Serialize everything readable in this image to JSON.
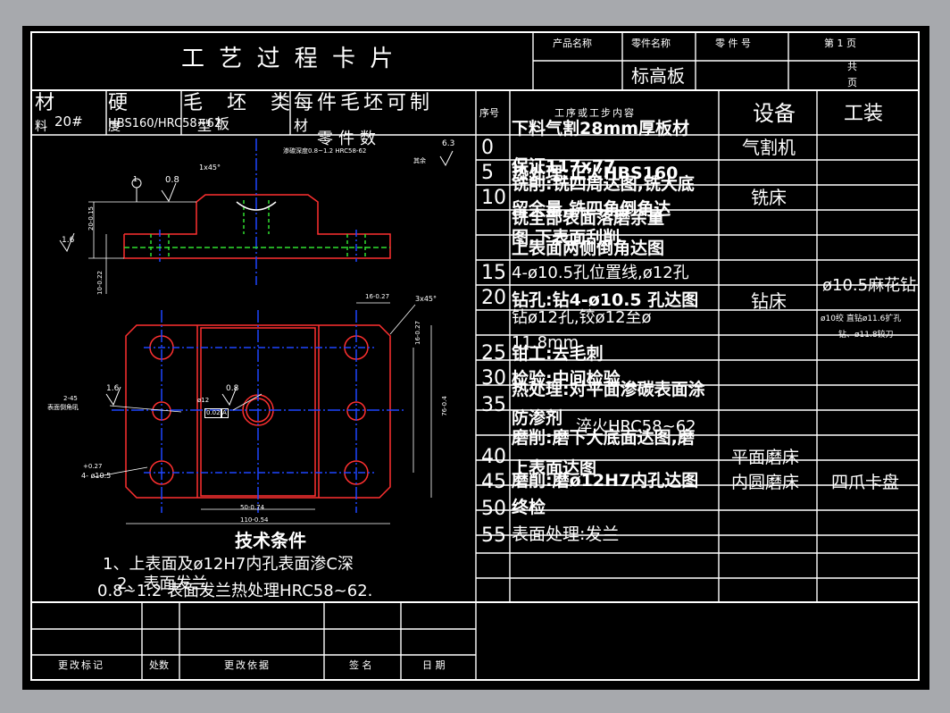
{
  "card": {
    "title": "工 艺 过 程 卡 片",
    "product_name_label": "产品名称",
    "part_name_label": "零件名称",
    "part_number_label": "零 件 号",
    "page_label": "第  1  页",
    "part_name_value": "标高板",
    "total_label": "共",
    "page_unit": "页"
  },
  "material_row": {
    "material_label": "材",
    "material_label_2": "料",
    "material_value": "20#",
    "hardness_label": "硬",
    "hardness_label_2": "度",
    "hardness_value": "HBS160/HRC58~62",
    "blank_type_label": "毛 坯 类",
    "blank_type_label_2": "型",
    "blank_type_value": "板",
    "per_blank_label": "每件毛坯可制",
    "per_blank_label_2": "材",
    "part_count_label": "零件数"
  },
  "process_table": {
    "headers": {
      "seq": "序号",
      "content": "工序或工步内容",
      "equipment": "设备",
      "tooling": "工装"
    },
    "rows": [
      {
        "seq": "0",
        "content": "下料气割28mm厚板材",
        "equipment": "气割机",
        "tooling": ""
      },
      {
        "seq": "5",
        "content": "保证117x77",
        "equipment": "",
        "tooling": ""
      },
      {
        "seq": "5",
        "content": "热处理:正火HBS160",
        "equipment": "",
        "tooling": ""
      },
      {
        "seq": "10",
        "content": "铣削:铣四周达图,铣大底",
        "equipment": "铣床",
        "tooling": ""
      },
      {
        "seq": "",
        "content": "留余量,铣四角倒角达",
        "equipment": "",
        "tooling": ""
      },
      {
        "seq": "",
        "content": "铣全部表面落磨余量",
        "equipment": "",
        "tooling": ""
      },
      {
        "seq": "",
        "content": "图,下表面刮削",
        "equipment": "",
        "tooling": ""
      },
      {
        "seq": "",
        "content": "上表面两侧倒角达图",
        "equipment": "",
        "tooling": ""
      },
      {
        "seq": "15",
        "content": "4-ø10.5孔位置线,ø12孔",
        "equipment": "",
        "tooling": ""
      },
      {
        "seq": "20",
        "content": "钻孔:钻4-ø10.5 孔达图",
        "equipment": "钻床",
        "tooling": "ø10.5麻花钻"
      },
      {
        "seq": "",
        "content": "钻ø12孔,铰ø12至ø",
        "equipment": "",
        "tooling": ""
      },
      {
        "seq": "",
        "content": "11.8mm",
        "equipment": "",
        "tooling": ""
      },
      {
        "seq": "25",
        "content": "钳工:去毛刺",
        "equipment": "",
        "tooling": ""
      },
      {
        "seq": "30",
        "content": "检验:中间检验",
        "equipment": "",
        "tooling": ""
      },
      {
        "seq": "35",
        "content": "热处理:对平面渗碳表面涂",
        "equipment": "",
        "tooling": ""
      },
      {
        "seq": "",
        "content": "防渗剂",
        "equipment": "",
        "tooling": ""
      },
      {
        "seq": "",
        "content": "淬火HRC58~62",
        "equipment": "",
        "tooling": ""
      },
      {
        "seq": "40",
        "content": "磨削:磨下大底面达图,磨",
        "equipment": "平面磨床",
        "tooling": ""
      },
      {
        "seq": "",
        "content": "上表面达图",
        "equipment": "",
        "tooling": ""
      },
      {
        "seq": "45",
        "content": "磨削:磨ø12H7内孔达图",
        "equipment": "内圆磨床",
        "tooling": "四爪卡盘"
      },
      {
        "seq": "50",
        "content": "终检",
        "equipment": "",
        "tooling": ""
      },
      {
        "seq": "55",
        "content": "表面处理:发兰",
        "equipment": "",
        "tooling": ""
      }
    ],
    "tooling_note_1": "ø10绞 直钻ø11.6扩孔",
    "tooling_note_2": "钻、ø11.8铰刀"
  },
  "drawing": {
    "annotations": {
      "chamfer_1": "1x45°",
      "chamfer_2": "3x45°",
      "carburize_note": "渗碳深度0.8~1.2 HRC58-62",
      "roughness_63": "6.3",
      "remaining": "其余",
      "roughness_08": "0.8",
      "roughness_16": "1.6",
      "datum_1": "1",
      "hole_spec": "4- ø10.5",
      "hole_tol": "+0.27",
      "chamfer_note": "2-45",
      "chamfer_note_2": "表面倒角吼",
      "center_hole": "ø12",
      "flatness": "0.02",
      "datum_a": "A",
      "dim_width_1": "50-0.74",
      "dim_width_2": "110-0.54",
      "dim_height_1": "76-0.4",
      "dim_height_2": "16-0.27",
      "dim_height_3": "20-0.15",
      "dim_height_4": "10-0.22",
      "dim_top": "16-0.27",
      "dim_0": "0"
    },
    "tech_title": "技术条件",
    "tech_line_1": "1、上表面及ø12H7内孔表面渗C深",
    "tech_line_2": "0.8~1.2 表面发兰热处理HRC58~62.",
    "tech_line_2b": "2、表面发兰"
  },
  "footer": {
    "change_mark": "更改标记",
    "count": "处数",
    "change_basis": "更改依据",
    "sign": "签 名",
    "date": "日 期"
  },
  "colors": {
    "background": "#000000",
    "outline": "#ffffff",
    "part_outline": "#ff3030",
    "centerline": "#1e46ff",
    "hidden_line": "#30e030",
    "frame_bg": "#a7a9ad"
  }
}
